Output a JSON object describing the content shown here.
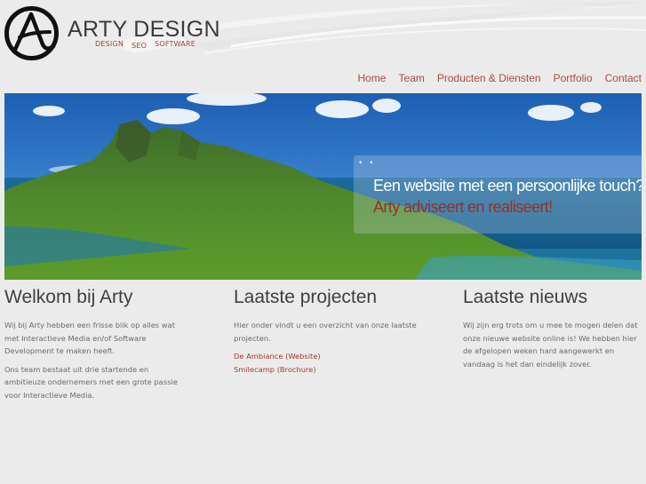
{
  "brand": {
    "name": "ARTY DESIGN",
    "tags": [
      "DESIGN",
      "SEO",
      "SOFTWARE"
    ]
  },
  "nav": [
    "Home",
    "Team",
    "Producten & Diensten",
    "Portfolio",
    "Contact"
  ],
  "hero": {
    "dots": "• •",
    "line1": "Een website met een persoonlijke touch?",
    "line2": "Arty adviseert en realiseert!"
  },
  "welcome": {
    "title": "Welkom bij Arty",
    "p1": "Wij bij Arty hebben een frisse blik op alles wat met Interactieve Media en/of Software Development te maken heeft.",
    "p2": "Ons team bestaat uit drie startende en ambitieuze ondernemers met een grote passie voor Interactieve Media."
  },
  "projects": {
    "title": "Laatste projecten",
    "intro": "Hier onder vindt u een overzicht van onze laatste projecten.",
    "links": [
      "De Ambiance (Website)",
      "Smilecamp (Brochure)"
    ]
  },
  "news": {
    "title": "Laatste nieuws",
    "p1": "Wij zijn erg trots om u mee te mogen delen dat onze nieuwe website online is! We hebben hier de afgelopen weken hard aangewerkt en vandaag is het dan eindelijk zover."
  }
}
